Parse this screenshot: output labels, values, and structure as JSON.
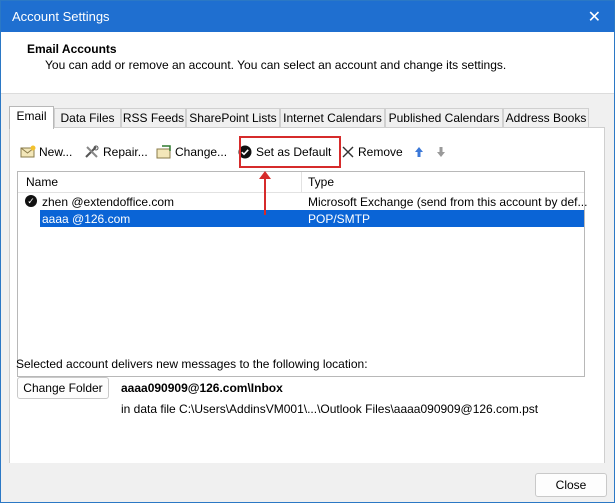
{
  "window": {
    "title": "Account Settings",
    "close_glyph": "✕"
  },
  "header": {
    "title": "Email Accounts",
    "subtitle": "You can add or remove an account. You can select an account and change its settings."
  },
  "tabs": [
    {
      "label": "Email",
      "active": true
    },
    {
      "label": "Data Files"
    },
    {
      "label": "RSS Feeds"
    },
    {
      "label": "SharePoint Lists"
    },
    {
      "label": "Internet Calendars"
    },
    {
      "label": "Published Calendars"
    },
    {
      "label": "Address Books"
    }
  ],
  "toolbar": {
    "new": "New...",
    "repair": "Repair...",
    "change": "Change...",
    "set_default": "Set as Default",
    "remove": "Remove",
    "icons": {
      "new": "mail-new-icon",
      "repair": "tools-icon",
      "change": "change-icon",
      "set_default": "check-circle-icon",
      "remove": "x-icon",
      "up": "arrow-up-icon",
      "down": "arrow-down-icon"
    }
  },
  "list": {
    "columns": [
      "Name",
      "Type"
    ],
    "rows": [
      {
        "name": "zhen        @extendoffice.com",
        "type": "Microsoft Exchange (send from this account by def...",
        "default": true,
        "selected": false
      },
      {
        "name": "aaaa        @126.com",
        "type": "POP/SMTP",
        "default": false,
        "selected": true
      }
    ]
  },
  "delivery": {
    "label": "Selected account delivers new messages to the following location:",
    "change_folder": "Change Folder",
    "inbox": "aaaa090909@126.com\\Inbox",
    "data_file": "in data file C:\\Users\\AddinsVM001\\...\\Outlook Files\\aaaa090909@126.com.pst"
  },
  "footer": {
    "close": "Close"
  },
  "colors": {
    "titlebar": "#1f6fd0",
    "selection": "#0a64d6",
    "highlight": "#d62b2b"
  }
}
